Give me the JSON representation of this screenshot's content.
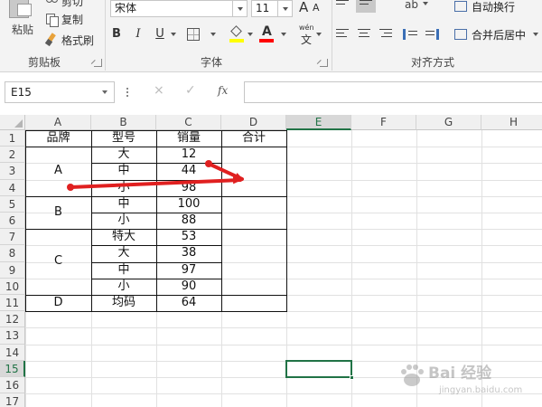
{
  "ribbon": {
    "clipboard": {
      "paste_label": "粘贴",
      "cut_label": "剪切",
      "copy_label": "复制",
      "format_painter_label": "格式刷",
      "group_label": "剪贴板"
    },
    "font": {
      "font_name": "宋体",
      "font_size": "11",
      "bold_label": "B",
      "italic_label": "I",
      "underline_label": "U",
      "wen_label": "wén",
      "wen_char": "文",
      "fill_color": "#ffff00",
      "font_color": "#ff0000",
      "group_label": "字体"
    },
    "alignment": {
      "wrap_text_label": "自动换行",
      "merge_center_label": "合并后居中",
      "group_label": "对齐方式"
    }
  },
  "formula_bar": {
    "name_box": "E15",
    "cancel_icon": "×",
    "enter_icon": "✓",
    "fx_label": "fx",
    "formula": ""
  },
  "sheet": {
    "columns": [
      "A",
      "B",
      "C",
      "D",
      "E",
      "F",
      "G",
      "H"
    ],
    "selected_column": "E",
    "rows": [
      "1",
      "2",
      "3",
      "4",
      "5",
      "6",
      "7",
      "8",
      "9",
      "10",
      "11",
      "12",
      "13",
      "14",
      "15",
      "16",
      "17"
    ],
    "selected_row": "15",
    "selected_cell": "E15",
    "headers": {
      "brand": "品牌",
      "model": "型号",
      "sales": "销量",
      "total": "合计"
    },
    "brands": {
      "A": "A",
      "B": "B",
      "C": "C",
      "D": "D"
    },
    "models": [
      "大",
      "中",
      "小",
      "中",
      "小",
      "特大",
      "大",
      "中",
      "小",
      "均码"
    ],
    "sales": [
      "12",
      "44",
      "98",
      "100",
      "88",
      "53",
      "38",
      "97",
      "90",
      "64"
    ]
  },
  "annotation": {
    "arrow_color": "#e02020"
  },
  "watermark": {
    "text": "Bai 经验",
    "sub": "jingyan.baidu.com"
  }
}
